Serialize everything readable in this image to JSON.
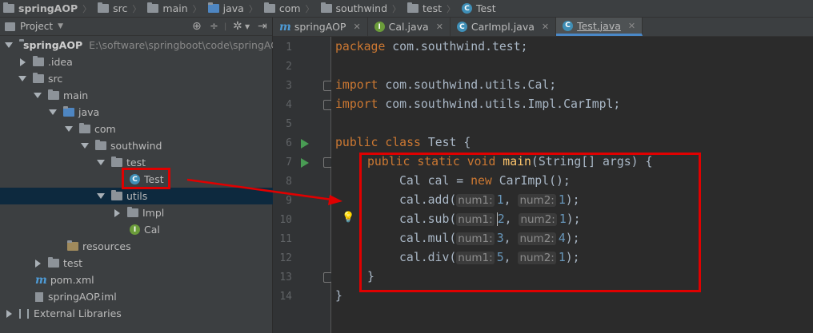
{
  "breadcrumb": [
    "springAOP",
    "src",
    "main",
    "java",
    "com",
    "southwind",
    "test",
    "Test"
  ],
  "project_panel": {
    "title": "Project",
    "tree": [
      {
        "label": "springAOP",
        "path": "E:\\software\\springboot\\code\\springAOP",
        "type": "module",
        "state": "expanded"
      },
      {
        "label": ".idea",
        "type": "folder",
        "state": "collapsed"
      },
      {
        "label": "src",
        "type": "folder",
        "state": "expanded"
      },
      {
        "label": "main",
        "type": "folder",
        "state": "expanded"
      },
      {
        "label": "java",
        "type": "source-folder",
        "state": "expanded"
      },
      {
        "label": "com",
        "type": "package",
        "state": "expanded"
      },
      {
        "label": "southwind",
        "type": "package",
        "state": "expanded"
      },
      {
        "label": "test",
        "type": "package",
        "state": "expanded"
      },
      {
        "label": "Test",
        "type": "class",
        "selected": true
      },
      {
        "label": "utils",
        "type": "package",
        "state": "expanded"
      },
      {
        "label": "Impl",
        "type": "package",
        "state": "collapsed"
      },
      {
        "label": "Cal",
        "type": "interface"
      },
      {
        "label": "resources",
        "type": "resources-folder"
      },
      {
        "label": "test",
        "type": "folder",
        "state": "collapsed"
      },
      {
        "label": "pom.xml",
        "type": "maven"
      },
      {
        "label": "springAOP.iml",
        "type": "iml"
      },
      {
        "label": "External Libraries",
        "type": "libraries",
        "state": "collapsed"
      }
    ]
  },
  "tabs": [
    {
      "label": "springAOP",
      "icon": "maven-icon",
      "active": false
    },
    {
      "label": "Cal.java",
      "icon": "interface-icon",
      "active": false
    },
    {
      "label": "CarImpl.java",
      "icon": "class-icon",
      "active": false
    },
    {
      "label": "Test.java",
      "icon": "class-icon",
      "active": true
    }
  ],
  "editor": {
    "line_numbers": [
      "1",
      "2",
      "3",
      "4",
      "5",
      "6",
      "7",
      "8",
      "9",
      "10",
      "11",
      "12",
      "13",
      "14"
    ],
    "lines": {
      "l1": {
        "kw": "package",
        "rest": " com.southwind.test;"
      },
      "l3": {
        "kw": "import",
        "rest": " com.southwind.utils.Cal;"
      },
      "l4": {
        "kw": "import",
        "rest": " com.southwind.utils.Impl.CarImpl;"
      },
      "l6": {
        "kw": "public class",
        "rest": " Test {"
      },
      "l7": {
        "kw": "public static void",
        "fn": "main",
        "rest": "(String[] args) {"
      },
      "l8": {
        "pre": "Cal cal = ",
        "kw": "new",
        "rest": " CarImpl();"
      },
      "l9": {
        "call": "cal.add(",
        "h1": "num1:",
        "v1": "1",
        "mid": ", ",
        "h2": "num2:",
        "v2": "1",
        "end": ");"
      },
      "l10": {
        "call": "cal.sub(",
        "h1": "num1:",
        "v1": "2",
        "mid": ", ",
        "h2": "num2:",
        "v2": "1",
        "end": ");"
      },
      "l11": {
        "call": "cal.mul(",
        "h1": "num1:",
        "v1": "3",
        "mid": ", ",
        "h2": "num2:",
        "v2": "4",
        "end": ");"
      },
      "l12": {
        "call": "cal.div(",
        "h1": "num1:",
        "v1": "5",
        "mid": ", ",
        "h2": "num2:",
        "v2": "1",
        "end": ");"
      },
      "l13": {
        "rest": "}"
      },
      "l14": {
        "rest": "}"
      }
    }
  },
  "annotations": {
    "highlight_color": "#e00000"
  },
  "colors": {
    "keyword": "#cc7832",
    "method": "#ffc66d",
    "number": "#6897bb",
    "text": "#a9b7c6",
    "selection": "#0d293e"
  }
}
